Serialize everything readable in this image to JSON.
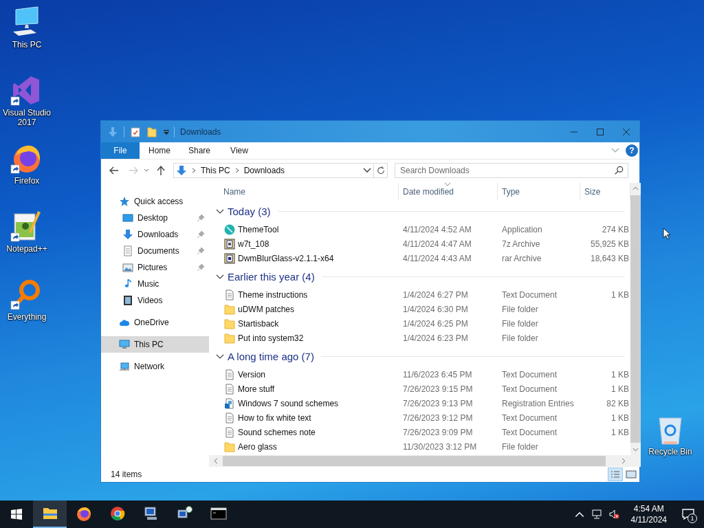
{
  "desktop_icons": [
    {
      "label": "This PC",
      "kind": "pc",
      "shortcut": false
    },
    {
      "label": "Visual Studio 2017",
      "kind": "vs",
      "shortcut": true
    },
    {
      "label": "Firefox",
      "kind": "firefox",
      "shortcut": true
    },
    {
      "label": "Notepad++",
      "kind": "notepad",
      "shortcut": true
    },
    {
      "label": "Everything",
      "kind": "everything",
      "shortcut": true
    }
  ],
  "recycle_bin": {
    "label": "Recycle Bin"
  },
  "window": {
    "title": "Downloads",
    "ribbon_tabs": [
      {
        "label": "File",
        "kind": "file"
      },
      {
        "label": "Home",
        "kind": "tab"
      },
      {
        "label": "Share",
        "kind": "tab"
      },
      {
        "label": "View",
        "kind": "tab"
      }
    ],
    "help_button": "?",
    "address": {
      "path": [
        "This PC",
        "Downloads"
      ]
    },
    "search": {
      "placeholder": "Search Downloads"
    },
    "navigation": [
      {
        "label": "Quick access",
        "kind": "star",
        "selected": false,
        "children": [
          {
            "label": "Desktop",
            "kind": "desktop",
            "pinned": true,
            "selected": false
          },
          {
            "label": "Downloads",
            "kind": "download",
            "pinned": true,
            "selected": false
          },
          {
            "label": "Documents",
            "kind": "document",
            "pinned": true,
            "selected": false
          },
          {
            "label": "Pictures",
            "kind": "picture",
            "pinned": true,
            "selected": false
          },
          {
            "label": "Music",
            "kind": "music",
            "pinned": false,
            "selected": false
          },
          {
            "label": "Videos",
            "kind": "video",
            "pinned": false,
            "selected": false
          }
        ]
      },
      {
        "label": "OneDrive",
        "kind": "cloud",
        "selected": false
      },
      {
        "label": "This PC",
        "kind": "pc",
        "selected": true
      },
      {
        "label": "Network",
        "kind": "network",
        "selected": false
      }
    ],
    "columns": [
      {
        "label": "Name",
        "sorted": false
      },
      {
        "label": "Date modified",
        "sorted": true
      },
      {
        "label": "Type",
        "sorted": false
      },
      {
        "label": "Size",
        "sorted": false
      }
    ],
    "groups": [
      {
        "title": "Today (3)",
        "expanded": true,
        "files": [
          {
            "name": "ThemeTool",
            "date": "4/11/2024 4:52 AM",
            "type": "Application",
            "size": "274 KB",
            "kind": "app"
          },
          {
            "name": "w7t_108",
            "date": "4/11/2024 4:47 AM",
            "type": "7z Archive",
            "size": "55,925 KB",
            "kind": "archive"
          },
          {
            "name": "DwmBlurGlass-v2.1.1-x64",
            "date": "4/11/2024 4:43 AM",
            "type": "rar Archive",
            "size": "18,643 KB",
            "kind": "rar"
          }
        ]
      },
      {
        "title": "Earlier this year (4)",
        "expanded": true,
        "files": [
          {
            "name": "Theme instructions",
            "date": "1/4/2024 6:27 PM",
            "type": "Text Document",
            "size": "1 KB",
            "kind": "text"
          },
          {
            "name": "uDWM patches",
            "date": "1/4/2024 6:30 PM",
            "type": "File folder",
            "kind": "folder"
          },
          {
            "name": "Startisback",
            "date": "1/4/2024 6:25 PM",
            "type": "File folder",
            "kind": "folder"
          },
          {
            "name": "Put into system32",
            "date": "1/4/2024 6:23 PM",
            "type": "File folder",
            "kind": "folder"
          }
        ]
      },
      {
        "title": "A long time ago (7)",
        "expanded": true,
        "files": [
          {
            "name": "Version",
            "date": "11/6/2023 6:45 PM",
            "type": "Text Document",
            "size": "1 KB",
            "kind": "text"
          },
          {
            "name": "More stuff",
            "date": "7/26/2023 9:15 PM",
            "type": "Text Document",
            "size": "1 KB",
            "kind": "text"
          },
          {
            "name": "Windows 7 sound schemes",
            "date": "7/26/2023 9:13 PM",
            "type": "Registration Entries",
            "size": "82 KB",
            "kind": "reg"
          },
          {
            "name": "How to fix white text",
            "date": "7/26/2023 9:12 PM",
            "type": "Text Document",
            "size": "1 KB",
            "kind": "text"
          },
          {
            "name": "Sound schemes note",
            "date": "7/26/2023 9:09 PM",
            "type": "Text Document",
            "size": "1 KB",
            "kind": "text"
          },
          {
            "name": "Aero glass",
            "date": "11/30/2023 3:12 PM",
            "type": "File folder",
            "kind": "folder"
          }
        ]
      }
    ],
    "status": {
      "count": "14 items"
    }
  },
  "taskbar": {
    "apps": [
      {
        "kind": "explorer",
        "active": true
      },
      {
        "kind": "firefox",
        "active": false
      },
      {
        "kind": "chrome",
        "active": false
      },
      {
        "kind": "remote",
        "active": false
      },
      {
        "kind": "network",
        "active": false
      },
      {
        "kind": "console",
        "active": false
      }
    ],
    "clock": {
      "time": "4:54 AM",
      "date": "4/11/2024"
    },
    "notifications": {
      "count": "1"
    }
  }
}
